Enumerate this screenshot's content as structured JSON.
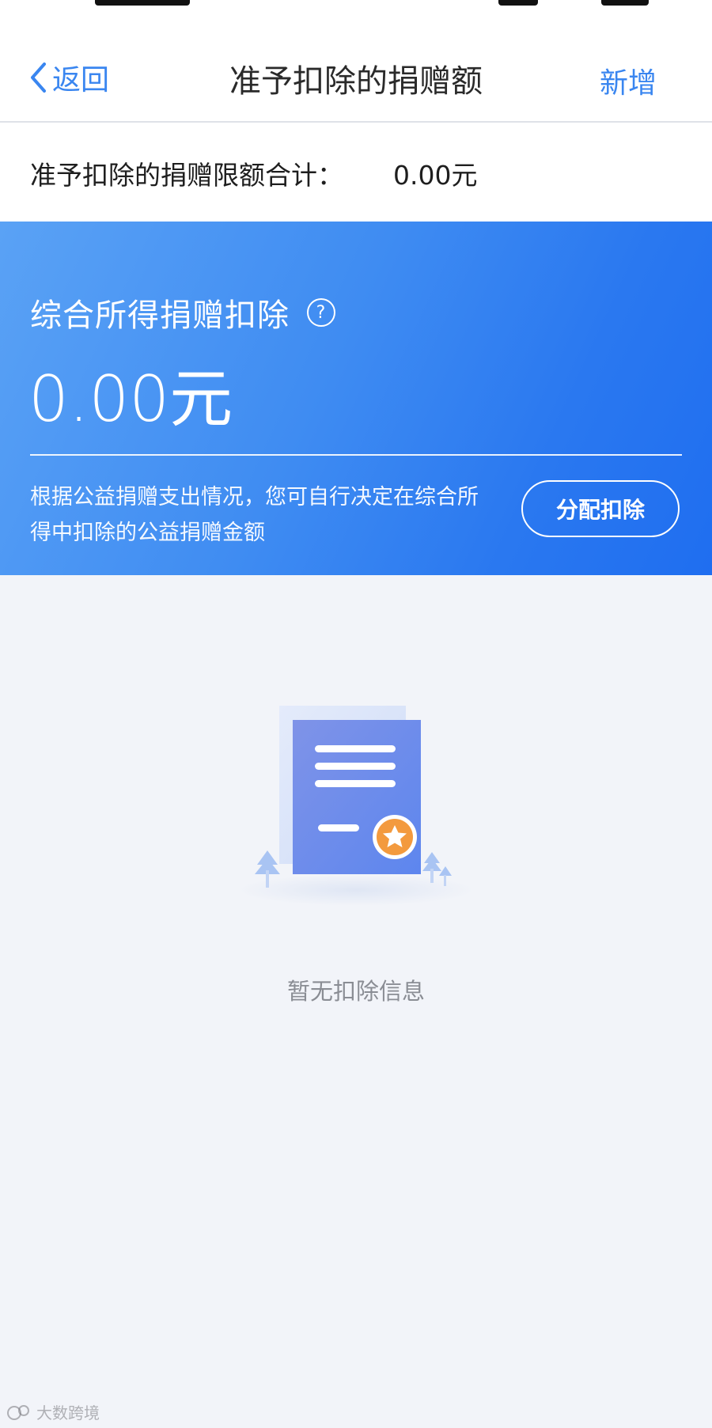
{
  "nav": {
    "back_label": "返回",
    "title": "准予扣除的捐赠额",
    "add_label": "新增"
  },
  "limit": {
    "label": "准予扣除的捐赠限额合计：",
    "value": "0.00元"
  },
  "hero": {
    "title": "综合所得捐赠扣除",
    "help_glyph": "?",
    "amount": "0.00元",
    "description": "根据公益捐赠支出情况，您可自行决定在综合所得中扣除的公益捐赠金额",
    "button_label": "分配扣除"
  },
  "empty": {
    "message": "暂无扣除信息"
  },
  "watermark": {
    "text": "大数跨境"
  },
  "colors": {
    "accent": "#3a86f0",
    "hero_start": "#5aa2f5",
    "hero_end": "#1f6ef0",
    "page_bg": "#f2f4f9",
    "star_badge": "#f39a3e"
  }
}
